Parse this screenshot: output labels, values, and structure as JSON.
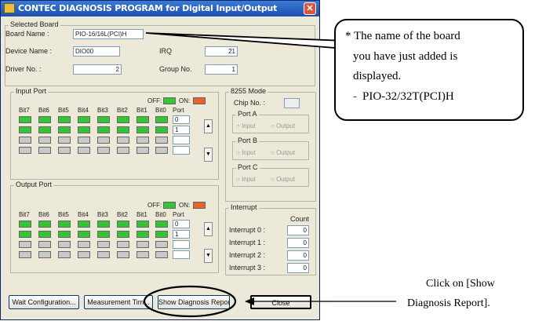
{
  "window": {
    "title": "CONTEC DIAGNOSIS PROGRAM for Digital Input/Output",
    "close_label": "✕"
  },
  "selected_board": {
    "group_label": "Selected Board",
    "board_name_label": "Board Name :",
    "board_name_value": "PIO-16/16L(PCI)H",
    "device_name_label": "Device Name :",
    "device_name_value": "DIO00",
    "irq_label": "IRQ",
    "irq_value": "21",
    "driver_no_label": "Driver No. :",
    "driver_no_value": "2",
    "group_no_label": "Group No.",
    "group_no_value": "1"
  },
  "input_port": {
    "group_label": "Input Port",
    "off_label": "OFF:",
    "on_label": "ON:",
    "bit_labels": [
      "Bit7",
      "Bit6",
      "Bit5",
      "Bit4",
      "Bit3",
      "Bit2",
      "Bit1",
      "Bit0",
      "Port"
    ],
    "rows": [
      {
        "port": "0",
        "state": "on"
      },
      {
        "port": "1",
        "state": "on"
      },
      {
        "port": "",
        "state": "off"
      },
      {
        "port": "",
        "state": "off"
      }
    ]
  },
  "output_port": {
    "group_label": "Output Port",
    "off_label": "OFF:",
    "on_label": "ON:",
    "bit_labels": [
      "Bit7",
      "Bit6",
      "Bit5",
      "Bit4",
      "Bit3",
      "Bit2",
      "Bit1",
      "Bit0",
      "Port"
    ],
    "rows": [
      {
        "port": "0",
        "state": "on"
      },
      {
        "port": "1",
        "state": "on"
      },
      {
        "port": "",
        "state": "off"
      },
      {
        "port": "",
        "state": "off"
      }
    ]
  },
  "mode_8255": {
    "group_label": "8255 Mode",
    "chip_no_label": "Chip No. :",
    "port_a_label": "Port A",
    "port_b_label": "Port B",
    "port_c_label": "Port C",
    "input_label": "Input",
    "output_label": "Output"
  },
  "interrupt": {
    "group_label": "Interrupt",
    "count_label": "Count",
    "rows": [
      {
        "label": "Interrupt 0 :",
        "count": "0"
      },
      {
        "label": "Interrupt 1 :",
        "count": "0"
      },
      {
        "label": "Interrupt 2 :",
        "count": "0"
      },
      {
        "label": "Interrupt 3 :",
        "count": "0"
      }
    ]
  },
  "buttons": {
    "wait_configuration": "Wait Configuration...",
    "measurement_time": "Measurement Tim...",
    "show_diagnosis_report": "Show Diagnosis Report...",
    "close": "Close"
  },
  "callout": {
    "line1": "* The name of the board",
    "line2": "you have just added is",
    "line3": "displayed.",
    "line4_dash": "-",
    "line4": "PIO-32/32T(PCI)H"
  },
  "note": {
    "line1": "Click on [Show",
    "line2": "Diagnosis Report]."
  },
  "colors": {
    "on": "#35c435",
    "off_indicator": "#35c435",
    "on_indicator": "#e8622a",
    "title_bar": "#1d4fb0"
  }
}
